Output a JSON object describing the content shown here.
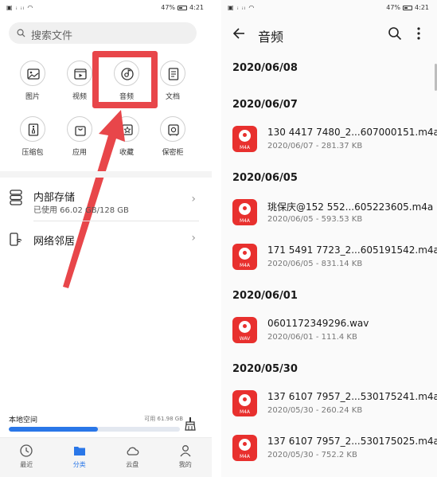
{
  "left": {
    "status": {
      "left": "▣ ᵢ ᵢₗ ◠",
      "battery": "47%",
      "time": "4:21"
    },
    "search": {
      "placeholder": "搜索文件"
    },
    "categories": [
      {
        "label": "图片",
        "icon": "image-icon"
      },
      {
        "label": "视频",
        "icon": "video-icon"
      },
      {
        "label": "音频",
        "icon": "audio-icon"
      },
      {
        "label": "文档",
        "icon": "document-icon"
      },
      {
        "label": "压缩包",
        "icon": "archive-icon"
      },
      {
        "label": "应用",
        "icon": "app-bag-icon"
      },
      {
        "label": "收藏",
        "icon": "favorite-icon"
      },
      {
        "label": "保密柜",
        "icon": "safe-icon"
      }
    ],
    "storage": {
      "title": "内部存储",
      "subtitle": "已使用 66.02 GB/128 GB"
    },
    "network": {
      "title": "网络邻居"
    },
    "local": {
      "title": "本地空间",
      "free": "可用 61.98 GB",
      "used_fraction": 0.52
    },
    "tabs": [
      {
        "label": "最近",
        "icon": "clock-icon"
      },
      {
        "label": "分类",
        "icon": "folder-icon",
        "active": true
      },
      {
        "label": "云盘",
        "icon": "cloud-icon"
      },
      {
        "label": "我的",
        "icon": "person-icon"
      }
    ],
    "highlight_color": "#e8464a",
    "accent_color": "#2a77e8"
  },
  "right": {
    "status": {
      "left": "▣ ᵢ ᵢₗ ◠",
      "battery": "47%",
      "time": "4:21"
    },
    "title": "音频",
    "groups": [
      {
        "date": "2020/06/08",
        "files": []
      },
      {
        "date": "2020/06/07",
        "files": [
          {
            "name": "130 4417 7480_2...607000151.m4a",
            "meta": "2020/06/07 - 281.37 KB",
            "ext": "M4A"
          }
        ]
      },
      {
        "date": "2020/06/05",
        "files": [
          {
            "name": "珧保庆@152 552...605223605.m4a",
            "meta": "2020/06/05 - 593.53 KB",
            "ext": "M4A"
          },
          {
            "name": "171 5491 7723_2...605191542.m4a",
            "meta": "2020/06/05 - 831.14 KB",
            "ext": "M4A"
          }
        ]
      },
      {
        "date": "2020/06/01",
        "files": [
          {
            "name": "0601172349296.wav",
            "meta": "2020/06/01 - 111.4 KB",
            "ext": "WAV"
          }
        ]
      },
      {
        "date": "2020/05/30",
        "files": [
          {
            "name": "137 6107 7957_2...530175241.m4a",
            "meta": "2020/05/30 - 260.24 KB",
            "ext": "M4A"
          },
          {
            "name": "137 6107 7957_2...530175025.m4a",
            "meta": "2020/05/30 - 752.2 KB",
            "ext": "M4A"
          }
        ]
      }
    ],
    "file_icon_color": "#e8302e"
  }
}
